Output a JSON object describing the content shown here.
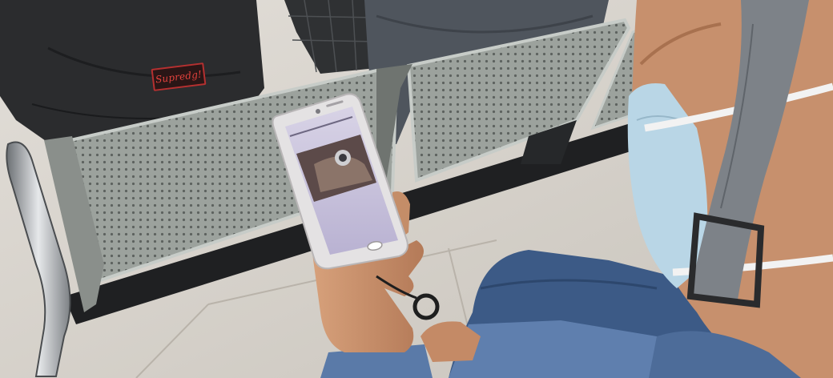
{
  "scene": {
    "jacket_patch_text": "Supredg!"
  },
  "colors": {
    "floor": "#d7d3cc",
    "bench_panel": "#9aa09b",
    "jeans": "#3c5a86",
    "skin": "#c98f6c",
    "mask": "#b9d6e6"
  }
}
